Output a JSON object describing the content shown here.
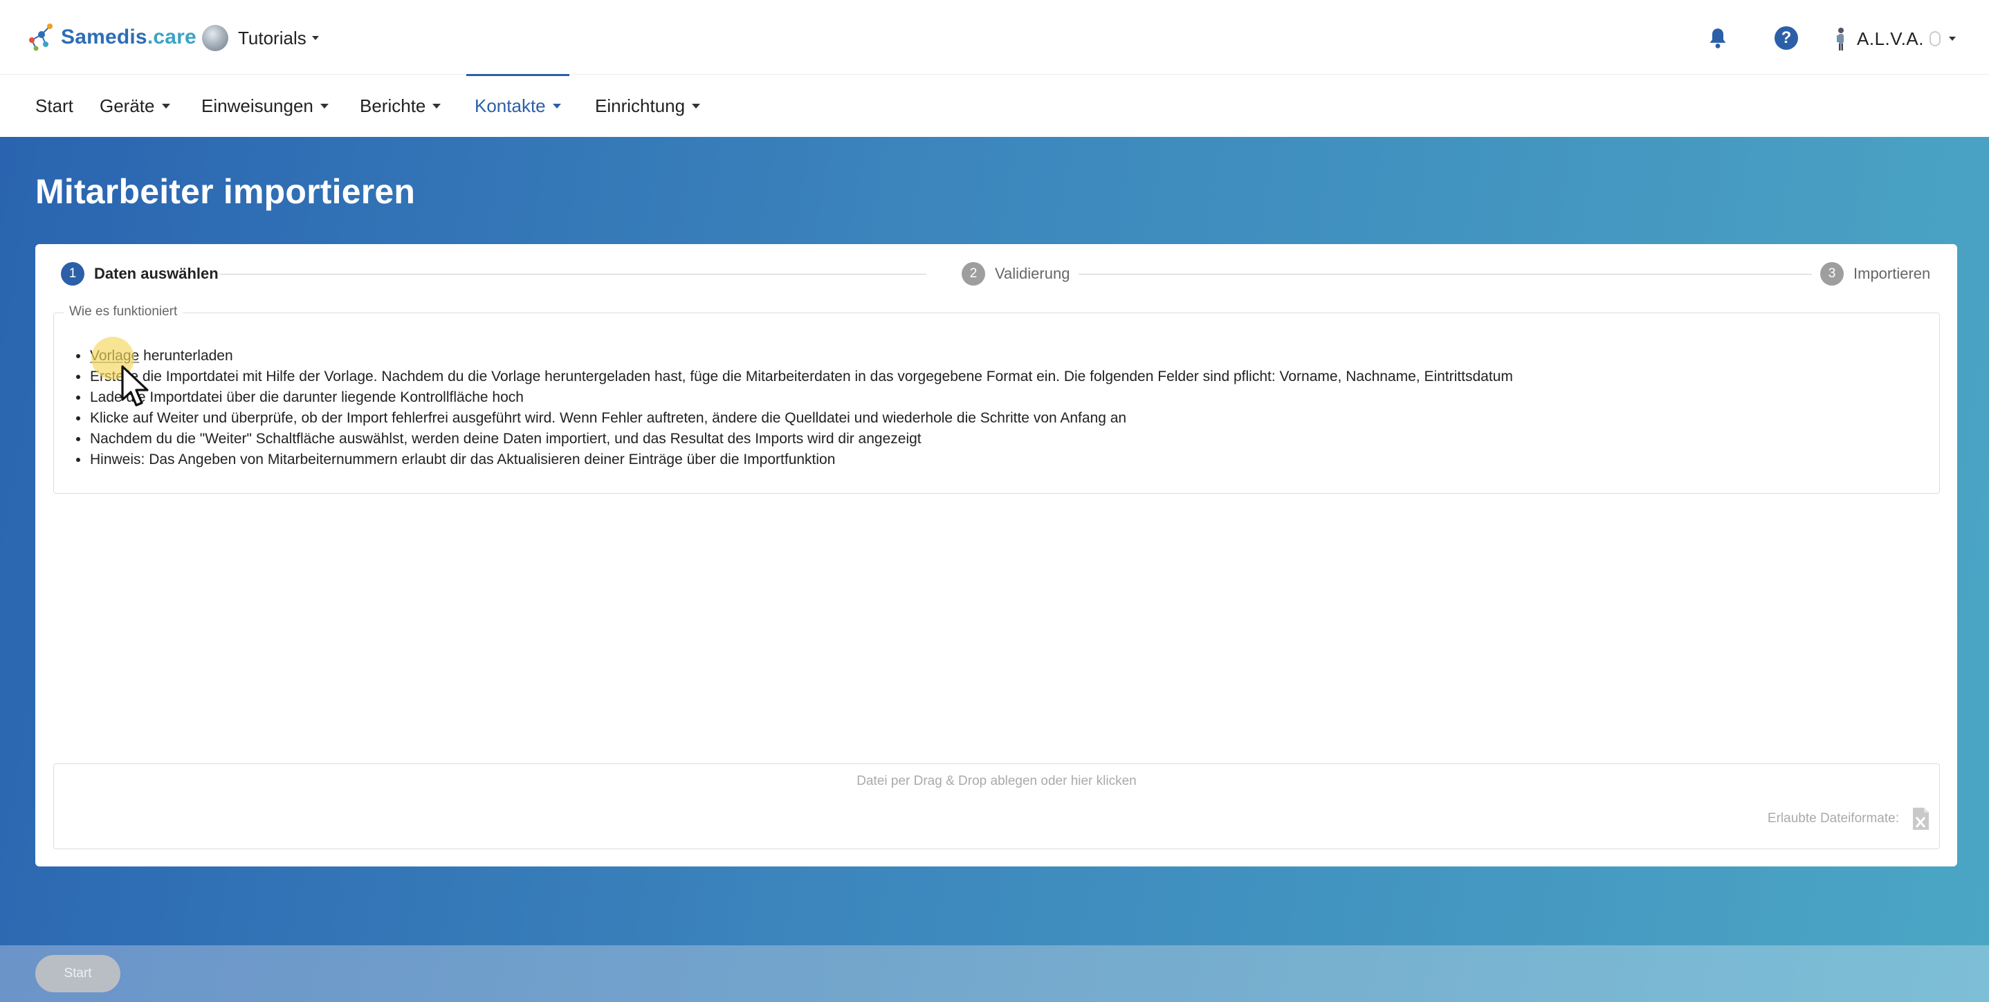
{
  "header": {
    "logo_part1": "Samedis",
    "logo_part2": ".care",
    "tenant": "Tutorials",
    "notifications_icon": "bell-icon",
    "help_icon": "question-circle-icon",
    "help_glyph": "?",
    "user_name": "A.L.V.A."
  },
  "nav": {
    "items": [
      {
        "label": "Start"
      },
      {
        "label": "Geräte"
      },
      {
        "label": "Einweisungen"
      },
      {
        "label": "Berichte"
      },
      {
        "label": "Kontakte"
      },
      {
        "label": "Einrichtung"
      }
    ],
    "active": "Kontakte"
  },
  "page": {
    "title": "Mitarbeiter importieren"
  },
  "stepper": {
    "steps": [
      {
        "number": "1",
        "label": "Daten auswählen",
        "active": true
      },
      {
        "number": "2",
        "label": "Validierung",
        "active": false
      },
      {
        "number": "3",
        "label": "Importieren",
        "active": false
      }
    ]
  },
  "instructions": {
    "legend": "Wie es funktioniert",
    "link_text": "Vorlage",
    "first_item_rest": " herunterladen",
    "items": [
      "Erstelle die Importdatei mit Hilfe der Vorlage. Nachdem du die Vorlage heruntergeladen hast, füge die Mitarbeiterdaten in das vorgegebene Format ein. Die folgenden Felder sind pflicht: Vorname, Nachname, Eintrittsdatum",
      "Lade die Importdatei über die darunter liegende Kontrollfläche hoch",
      "Klicke auf Weiter und überprüfe, ob der Import fehlerfrei ausgeführt wird. Wenn Fehler auftreten, ändere die Quelldatei und wiederhole die Schritte von Anfang an",
      "Nachdem du die \"Weiter\" Schaltfläche auswählst, werden deine Daten importiert, und das Resultat des Imports wird dir angezeigt",
      "Hinweis: Das Angeben von Mitarbeiternummern erlaubt dir das Aktualisieren deiner Einträge über die Importfunktion"
    ]
  },
  "dropzone": {
    "hint": "Datei per Drag & Drop ablegen oder hier klicken",
    "formats_label": "Erlaubte Dateiformate:",
    "format_icon": "excel-file-icon"
  },
  "footer": {
    "start_label": "Start",
    "start_disabled": true
  },
  "colors": {
    "primary": "#2b5fa8",
    "gradient_start": "#2a64b0",
    "gradient_end": "#4ba6c4",
    "step_inactive": "#9e9e9e"
  }
}
